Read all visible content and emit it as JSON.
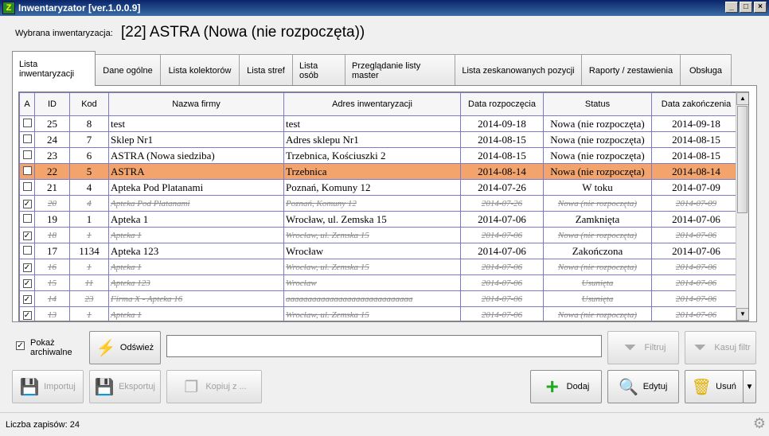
{
  "window": {
    "title": "Inwentaryzator [ver.1.0.0.9]",
    "controls": [
      "_",
      "□",
      "×"
    ]
  },
  "selected": {
    "label": "Wybrana inwentaryzacja:",
    "value": "[22] ASTRA (Nowa (nie rozpoczęta))"
  },
  "tabs": [
    {
      "label": "Lista inwentaryzacji"
    },
    {
      "label": "Dane ogólne"
    },
    {
      "label": "Lista kolektorów"
    },
    {
      "label": "Lista stref"
    },
    {
      "label": "Lista osób"
    },
    {
      "label": "Przeglądanie listy master"
    },
    {
      "label": "Lista zeskanowanych pozycji"
    },
    {
      "label": "Raporty / zestawienia"
    },
    {
      "label": "Obsługa"
    }
  ],
  "grid": {
    "columns": [
      "A",
      "ID",
      "Kod",
      "Nazwa firmy",
      "Adres inwentaryzacji",
      "Data rozpoczęcia",
      "Status",
      "Data zakończenia"
    ],
    "rows": [
      {
        "a": "",
        "id": "25",
        "kod": "8",
        "name": "test",
        "addr": "test",
        "start": "2014-09-18",
        "status": "Nowa (nie rozpoczęta)",
        "end": "2014-09-18",
        "state": "normal"
      },
      {
        "a": "",
        "id": "24",
        "kod": "7",
        "name": "Sklep Nr1",
        "addr": "Adres sklepu Nr1",
        "start": "2014-08-15",
        "status": "Nowa (nie rozpoczęta)",
        "end": "2014-08-15",
        "state": "normal"
      },
      {
        "a": "",
        "id": "23",
        "kod": "6",
        "name": "ASTRA (Nowa siedziba)",
        "addr": "Trzebnica, Kościuszki 2",
        "start": "2014-08-15",
        "status": "Nowa (nie rozpoczęta)",
        "end": "2014-08-15",
        "state": "normal"
      },
      {
        "a": "",
        "id": "22",
        "kod": "5",
        "name": "ASTRA",
        "addr": "Trzebnica",
        "start": "2014-08-14",
        "status": "Nowa (nie rozpoczęta)",
        "end": "2014-08-14",
        "state": "selected"
      },
      {
        "a": "",
        "id": "21",
        "kod": "4",
        "name": "Apteka Pod Platanami",
        "addr": "Poznań, Komuny 12",
        "start": "2014-07-26",
        "status": "W toku",
        "end": "2014-07-09",
        "state": "normal"
      },
      {
        "a": "✓",
        "id": "20",
        "kod": "4",
        "name": "Apteka Pod Platanami",
        "addr": "Poznań, Komuny 12",
        "start": "2014-07-26",
        "status": "Nowa (nie rozpoczęta)",
        "end": "2014-07-09",
        "state": "archived"
      },
      {
        "a": "",
        "id": "19",
        "kod": "1",
        "name": "Apteka 1",
        "addr": "Wrocław, ul. Zemska 15",
        "start": "2014-07-06",
        "status": "Zamknięta",
        "end": "2014-07-06",
        "state": "normal"
      },
      {
        "a": "✓",
        "id": "18",
        "kod": "1",
        "name": "Apteka 1",
        "addr": "Wrocław, ul. Zemska 15",
        "start": "2014-07-06",
        "status": "Nowa (nie rozpoczęta)",
        "end": "2014-07-06",
        "state": "archived"
      },
      {
        "a": "",
        "id": "17",
        "kod": "1134",
        "name": "Apteka 123",
        "addr": "Wrocław",
        "start": "2014-07-06",
        "status": "Zakończona",
        "end": "2014-07-06",
        "state": "normal"
      },
      {
        "a": "✓",
        "id": "16",
        "kod": "1",
        "name": "Apteka 1",
        "addr": "Wrocław, ul. Zemska 15",
        "start": "2014-07-06",
        "status": "Nowa (nie rozpoczęta)",
        "end": "2014-07-06",
        "state": "archived"
      },
      {
        "a": "✓",
        "id": "15",
        "kod": "11",
        "name": "Apteka 123",
        "addr": "Wrocław",
        "start": "2014-07-06",
        "status": "Usunięta",
        "end": "2014-07-06",
        "state": "archived"
      },
      {
        "a": "✓",
        "id": "14",
        "kod": "23",
        "name": "Firma X - Apteka 16",
        "addr": "aaaaaaaaaaaaaaaaaaaaaaaaaaaaa",
        "start": "2014-07-06",
        "status": "Usunięta",
        "end": "2014-07-06",
        "state": "archived"
      },
      {
        "a": "✓",
        "id": "13",
        "kod": "1",
        "name": "Apteka 1",
        "addr": "Wrocław, ul. Zemska 15",
        "start": "2014-07-06",
        "status": "Nowa (nie rozpoczęta)",
        "end": "2014-07-06",
        "state": "archived"
      }
    ]
  },
  "controls": {
    "show_archived": "Pokaż archiwalne",
    "refresh": "Odśwież",
    "filter_value": "",
    "filter": "Filtruj",
    "clear_filter": "Kasuj filtr",
    "import": "Importuj",
    "export": "Eksportuj",
    "copy_from": "Kopiuj z ...",
    "add": "Dodaj",
    "edit": "Edytuj",
    "delete": "Usuń"
  },
  "status": {
    "record_count": "Liczba zapisów: 24"
  },
  "colors": {
    "selected_row": "#f2a46c",
    "grid_line": "#7b7bc8",
    "title_bar": "#0a246a"
  }
}
